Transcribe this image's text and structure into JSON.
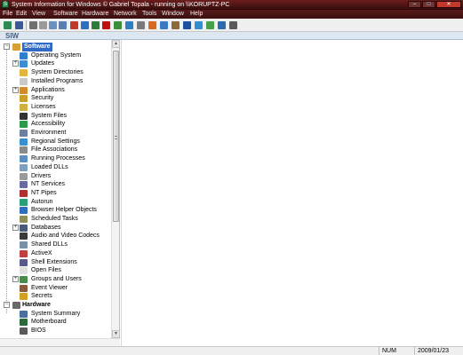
{
  "window": {
    "title": "System Information for Windows  © Gabriel Topala - running on \\\\KORUPTZ-PC",
    "app_icon_glyph": "S",
    "minimize_glyph": "–",
    "maximize_glyph": "□",
    "close_glyph": "✕"
  },
  "menu": [
    "File",
    "Edit",
    "View",
    "Software",
    "Hardware",
    "Network",
    "Tools",
    "Window",
    "Help"
  ],
  "toolbar": {
    "icons": [
      {
        "name": "siw-icon",
        "color": "#2e8b57"
      },
      {
        "name": "save-icon",
        "color": "#3a5a9a"
      },
      {
        "name": "print-icon",
        "color": "#707070"
      },
      {
        "name": "cut-icon",
        "color": "#9a9a9a"
      },
      {
        "name": "copy-icon",
        "color": "#6a8fc0"
      },
      {
        "name": "find-icon",
        "color": "#5b7fb0"
      },
      {
        "name": "stop-icon",
        "color": "#c0392b"
      },
      {
        "name": "help-icon",
        "color": "#2f6fbf"
      },
      {
        "name": "monitor-icon",
        "color": "#2d7d3a"
      },
      {
        "name": "drive-icon",
        "color": "#c01010"
      },
      {
        "name": "network-icon",
        "color": "#3a8f3a"
      },
      {
        "name": "refresh-icon",
        "color": "#2e7fbf"
      },
      {
        "name": "disk-icon",
        "color": "#7a7a7a"
      },
      {
        "name": "chip-icon",
        "color": "#d86a1f"
      },
      {
        "name": "sensor-icon",
        "color": "#3b79c4"
      },
      {
        "name": "tools-icon",
        "color": "#8a6d3b"
      },
      {
        "name": "shield-icon",
        "color": "#1f4f9f"
      },
      {
        "name": "globe-icon",
        "color": "#2f8fcf"
      },
      {
        "name": "user-icon",
        "color": "#4aa04a"
      },
      {
        "name": "info-icon",
        "color": "#2b6cb0"
      },
      {
        "name": "camera-icon",
        "color": "#5a5a5a"
      }
    ]
  },
  "siw_label": "SIW",
  "tree": {
    "expand_glyph": "+",
    "collapse_glyph": "−",
    "software": {
      "label": "Software",
      "items": [
        {
          "label": "Operating System",
          "icon": "windows-icon",
          "color": "#2f7fcf",
          "expander": false
        },
        {
          "label": "Updates",
          "icon": "update-icon",
          "color": "#3b8ed0",
          "expander": true
        },
        {
          "label": "System Directories",
          "icon": "folder-icon",
          "color": "#e3b53b",
          "expander": false
        },
        {
          "label": "Installed Programs",
          "icon": "programs-icon",
          "color": "#c9c9c9",
          "expander": false
        },
        {
          "label": "Applications",
          "icon": "applications-icon",
          "color": "#d28b2c",
          "expander": true
        },
        {
          "label": "Security",
          "icon": "security-icon",
          "color": "#c8a02a",
          "expander": false
        },
        {
          "label": "Licenses",
          "icon": "key-icon",
          "color": "#d0b040",
          "expander": false
        },
        {
          "label": "System Files",
          "icon": "system-files-icon",
          "color": "#333333",
          "expander": false
        },
        {
          "label": "Accessibility",
          "icon": "accessibility-icon",
          "color": "#2a9a4a",
          "expander": false
        },
        {
          "label": "Environment",
          "icon": "environment-icon",
          "color": "#6f7f9f",
          "expander": false
        },
        {
          "label": "Regional Settings",
          "icon": "globe-icon",
          "color": "#3a8fcf",
          "expander": false
        },
        {
          "label": "File Associations",
          "icon": "file-associations-icon",
          "color": "#8a8a8a",
          "expander": false
        },
        {
          "label": "Running Processes",
          "icon": "processes-icon",
          "color": "#5a8fc0",
          "expander": false
        },
        {
          "label": "Loaded DLLs",
          "icon": "dll-icon",
          "color": "#7f9fbf",
          "expander": false
        },
        {
          "label": "Drivers",
          "icon": "drivers-icon",
          "color": "#9a9a9a",
          "expander": false
        },
        {
          "label": "NT Services",
          "icon": "services-icon",
          "color": "#6a6aa0",
          "expander": false
        },
        {
          "label": "NT Pipes",
          "icon": "pipes-icon",
          "color": "#b03030",
          "expander": false
        },
        {
          "label": "Autorun",
          "icon": "autorun-icon",
          "color": "#2aa07a",
          "expander": false
        },
        {
          "label": "Browser Helper Objects",
          "icon": "bho-icon",
          "color": "#2f6fbf",
          "expander": false
        },
        {
          "label": "Scheduled Tasks",
          "icon": "scheduled-tasks-icon",
          "color": "#8f8f5a",
          "expander": false
        },
        {
          "label": "Databases",
          "icon": "database-icon",
          "color": "#4a5a7a",
          "expander": true
        },
        {
          "label": "Audio and Video Codecs",
          "icon": "codecs-icon",
          "color": "#3a3a3a",
          "expander": false
        },
        {
          "label": "Shared DLLs",
          "icon": "shared-dlls-icon",
          "color": "#7a8fa8",
          "expander": false
        },
        {
          "label": "ActiveX",
          "icon": "activex-icon",
          "color": "#c04040",
          "expander": false
        },
        {
          "label": "Shell Extensions",
          "icon": "shell-extensions-icon",
          "color": "#5a5a8a",
          "expander": false
        },
        {
          "label": "Open Files",
          "icon": "open-files-icon",
          "color": "#dfdfdf",
          "expander": false
        },
        {
          "label": "Groups and Users",
          "icon": "users-icon",
          "color": "#4a8a4a",
          "expander": true
        },
        {
          "label": "Event Viewer",
          "icon": "event-viewer-icon",
          "color": "#8a5a3a",
          "expander": false
        },
        {
          "label": "Secrets",
          "icon": "secrets-icon",
          "color": "#d0a020",
          "expander": false
        }
      ]
    },
    "hardware": {
      "label": "Hardware",
      "items": [
        {
          "label": "System Summary",
          "icon": "system-summary-icon",
          "color": "#4a6f9f",
          "expander": false
        },
        {
          "label": "Motherboard",
          "icon": "motherboard-icon",
          "color": "#2a6a3a",
          "expander": false
        },
        {
          "label": "BIOS",
          "icon": "bios-icon",
          "color": "#5a5a5a",
          "expander": false
        }
      ]
    }
  },
  "scrollbar": {
    "up_glyph": "▲",
    "down_glyph": "▼"
  },
  "status": {
    "num": "NUM",
    "datetime": "2009/01/23 17:02"
  }
}
